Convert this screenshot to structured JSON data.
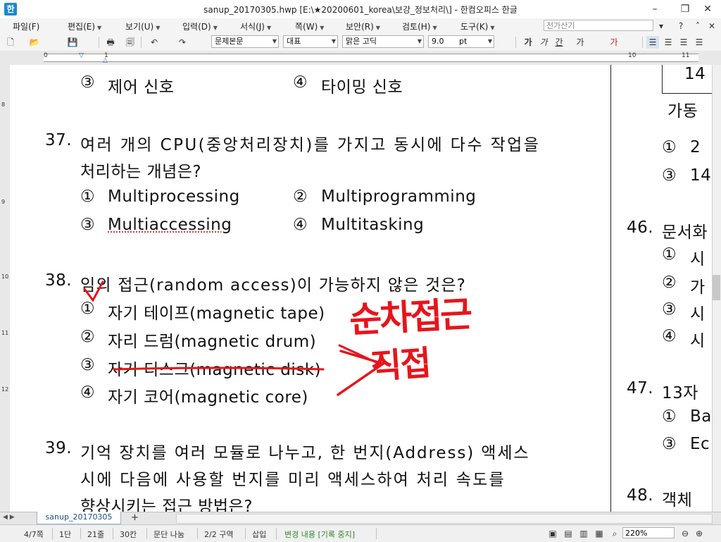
{
  "window": {
    "title": "sanup_20170305.hwp [E:\\★20200601_korea\\보강_정보처리\\] - 한컴오피스 한글",
    "app_icon_label": "한"
  },
  "menu": [
    "파일(F)",
    "편집(E)",
    "보기(U)",
    "입력(D)",
    "서식(J)",
    "쪽(W)",
    "보안(R)",
    "검토(H)",
    "도구(K)"
  ],
  "formula_box": {
    "placeholder": "전가산기"
  },
  "toolbar": {
    "style_combo": "문제본문",
    "lang_combo": "대표",
    "font_combo": "맑은 고딕",
    "size_combo": "9.0",
    "size_unit": "pt",
    "format_buttons": [
      "가",
      "가",
      "간",
      "가",
      "가"
    ]
  },
  "ruler": {
    "h_numbers": [
      "0",
      "1",
      "10",
      "11"
    ],
    "v_numbers": [
      "8",
      "9",
      "10",
      "11",
      "12"
    ]
  },
  "document": {
    "left": {
      "prev_opts": [
        {
          "num": "③",
          "text": "제어 신호"
        },
        {
          "num": "④",
          "text": "타이밍 신호"
        }
      ],
      "q37": {
        "num": "37.",
        "line1": "여러 개의 CPU(중앙처리장치)를 가지고 동시에 다수 작업을",
        "line2": "처리하는 개념은?",
        "opts": [
          {
            "num": "①",
            "text": "Multiprocessing"
          },
          {
            "num": "②",
            "text": "Multiprogramming"
          },
          {
            "num": "③",
            "text": "Multiaccessing"
          },
          {
            "num": "④",
            "text": "Multitasking"
          }
        ]
      },
      "q38": {
        "num": "38.",
        "line1": "임의 접근(random access)이 가능하지 않은 것은?",
        "opts": [
          {
            "num": "①",
            "text": "자기 테이프(magnetic tape)"
          },
          {
            "num": "②",
            "text": "자리 드럼(magnetic drum)"
          },
          {
            "num": "③",
            "text": "자기 디스크(magnetic disk)"
          },
          {
            "num": "④",
            "text": "자기 코어(magnetic core)"
          }
        ]
      },
      "q39": {
        "num": "39.",
        "line1": "기억 장치를 여러 모듈로 나누고, 한 번지(Address) 액세스",
        "line2": "시에 다음에 사용할 번지를 미리 액세스하여 처리 속도를",
        "line3": "향상시키는 접근 방법은?"
      }
    },
    "right": {
      "box_text": "14",
      "line_ga": "가동",
      "opts_a": [
        {
          "num": "①",
          "text": "2"
        },
        {
          "num": "③",
          "text": "14"
        }
      ],
      "q46": {
        "num": "46.",
        "text": "문서화"
      },
      "opts_b": [
        {
          "num": "①",
          "text": "시"
        },
        {
          "num": "②",
          "text": "가"
        },
        {
          "num": "③",
          "text": "시"
        },
        {
          "num": "④",
          "text": "시"
        }
      ],
      "q47": {
        "num": "47.",
        "text": "13자"
      },
      "opts_c": [
        {
          "num": "①",
          "text": "Ba"
        },
        {
          "num": "③",
          "text": "Ec"
        }
      ],
      "q48": {
        "num": "48.",
        "text": "객체"
      }
    },
    "annotations": {
      "note1": "순차접근",
      "note2": "직접"
    }
  },
  "tab": {
    "name": "sanup_20170305",
    "add": "+"
  },
  "status": {
    "page": "4/7쪽",
    "section": "1단",
    "line": "21줄",
    "column": "30칸",
    "split": "문단 나눔",
    "area": "2/2 구역",
    "insert": "삽입",
    "track": "변경 내용 [기록 중지]",
    "zoom": "220%"
  },
  "colors": {
    "annotation_red": "#e8141b",
    "track_green": "#2d8a2d"
  }
}
